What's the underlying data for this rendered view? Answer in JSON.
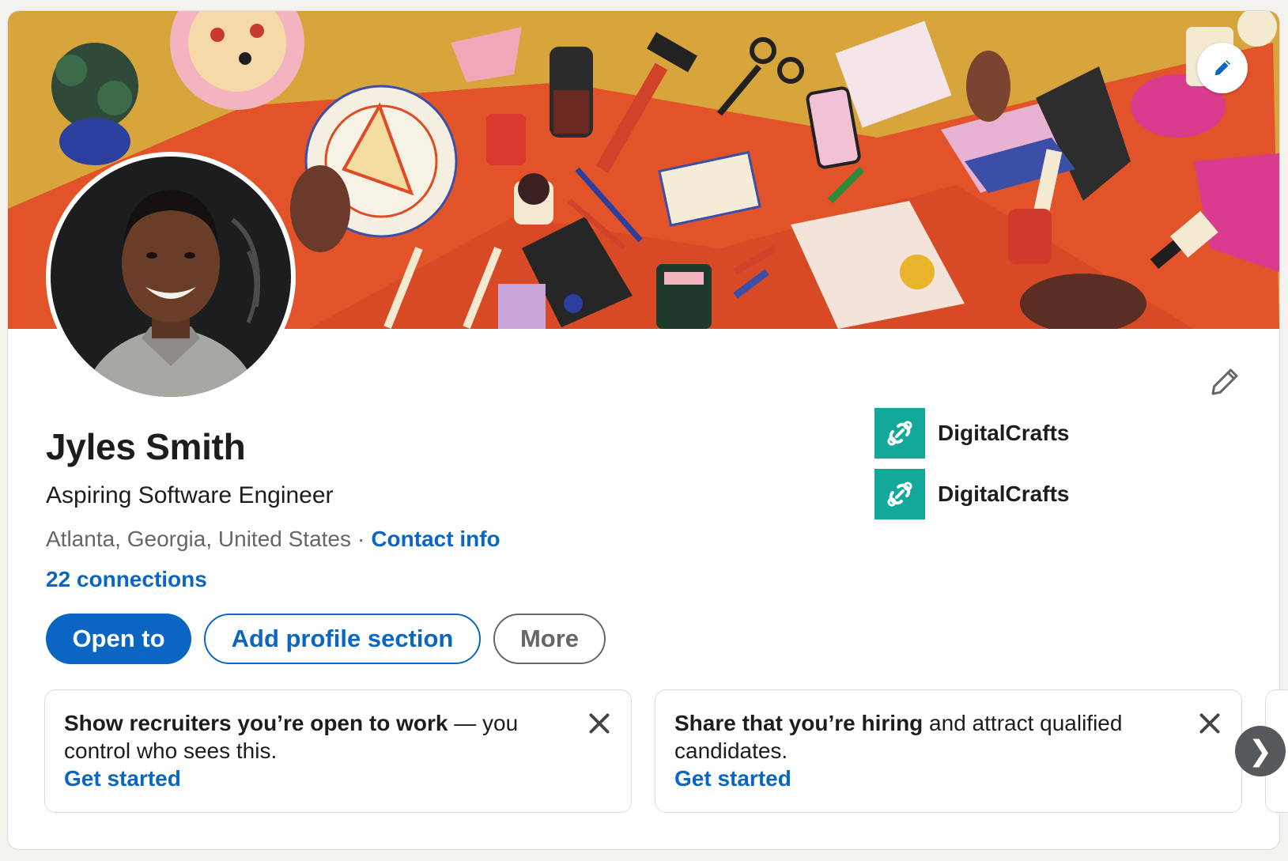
{
  "profile": {
    "name": "Jyles Smith",
    "headline": "Aspiring Software Engineer",
    "location": "Atlanta, Georgia, United States",
    "separator": "·",
    "contact_info": "Contact info",
    "connections": "22 connections"
  },
  "actions": {
    "open_to": "Open to",
    "add_profile_section": "Add profile section",
    "more": "More"
  },
  "experience": [
    {
      "org": "DigitalCrafts",
      "icon": "link-chain-icon"
    },
    {
      "org": "DigitalCrafts",
      "icon": "link-chain-icon"
    }
  ],
  "promos": [
    {
      "bold": "Show recruiters you’re open to work",
      "rest": " — you control who sees this.",
      "link": "Get started"
    },
    {
      "bold": "Share that you’re hiring",
      "rest": " and attract qualified candidates.",
      "link": "Get started"
    }
  ],
  "carousel": {
    "next_glyph": "❯"
  },
  "colors": {
    "accent": "#0a66c2",
    "org_logo": "#12a99a",
    "banner_base": "#d6a23a",
    "banner_orange": "#e2532a"
  }
}
